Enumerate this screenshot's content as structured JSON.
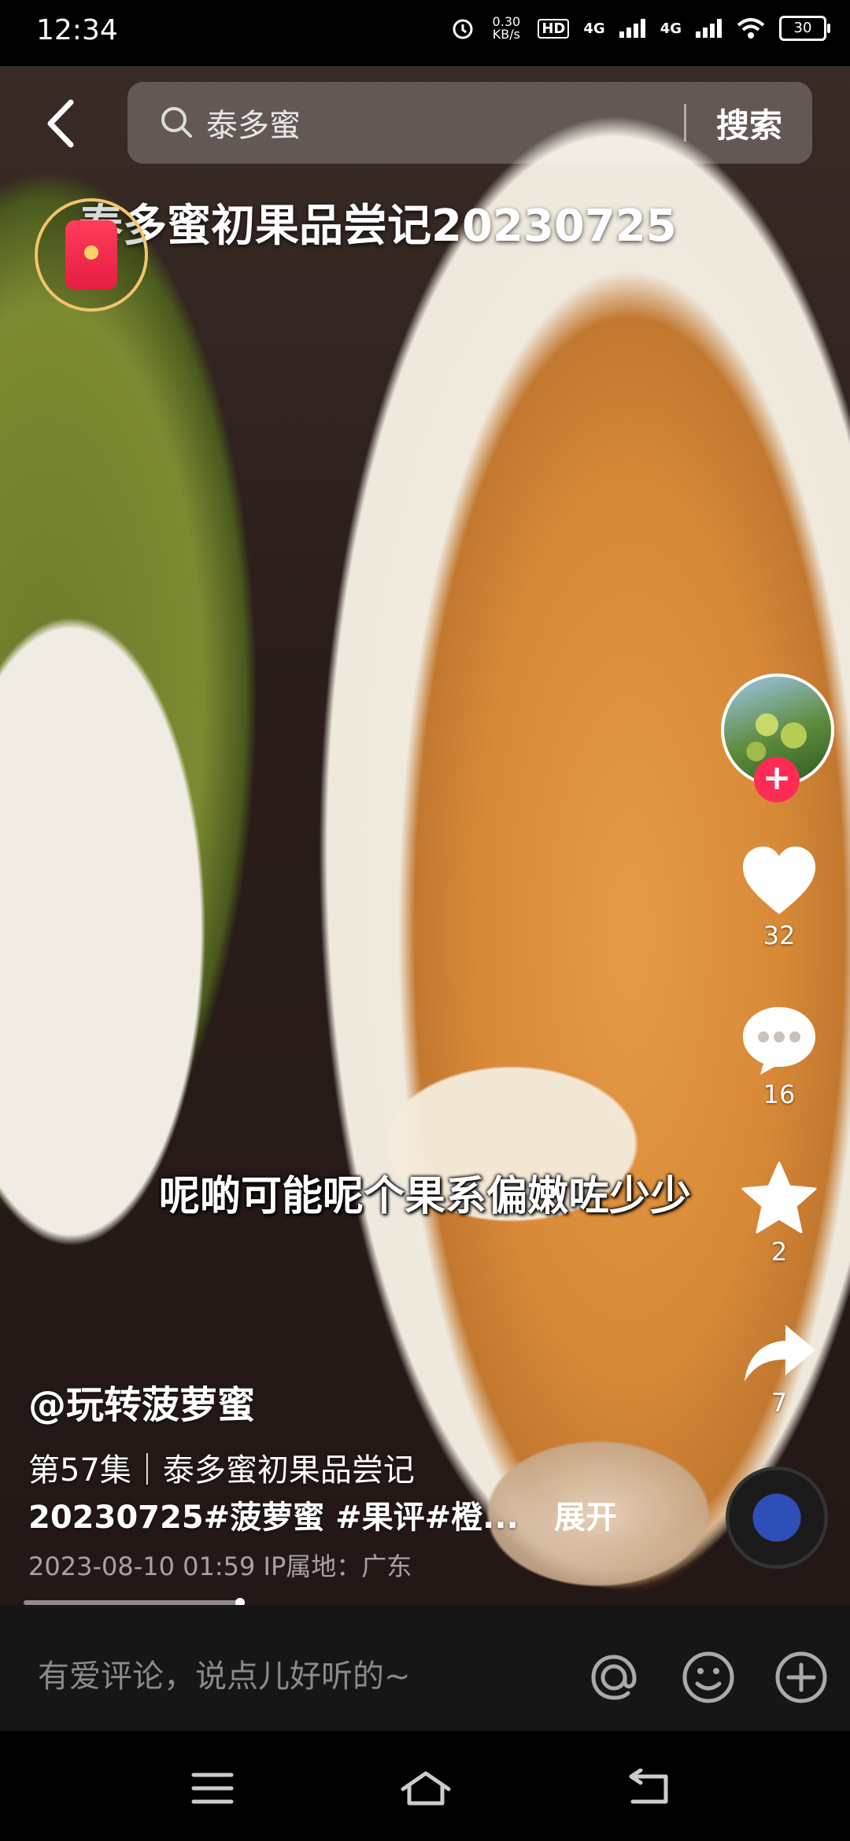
{
  "status_bar": {
    "time": "12:34",
    "net_speed": "0.30 KB/s",
    "hd_label": "HD",
    "signal1": "4G",
    "signal2": "4G",
    "battery": "30"
  },
  "search": {
    "query": "泰多蜜",
    "button": "搜索"
  },
  "video": {
    "title": "泰多蜜初果品尝记20230725",
    "subtitle": "呢啲可能呢个果系偏嫩咗少少",
    "progress": 0.27
  },
  "rail": {
    "likes": "32",
    "comments": "16",
    "favorites": "2",
    "shares": "7",
    "follow_label": "+"
  },
  "post": {
    "author": "@玩转菠萝蜜",
    "desc_line1": "第57集｜泰多蜜初果品尝记",
    "desc_line2": "20230725#菠萝蜜 #果评#橙...",
    "expand": "展开",
    "meta": "2023-08-10 01:59  IP属地：广东"
  },
  "comment_bar": {
    "placeholder": "有爱评论，说点儿好听的~"
  },
  "colors": {
    "accent": "#fe2c55",
    "redpacket_ring": "#f2c46a"
  }
}
